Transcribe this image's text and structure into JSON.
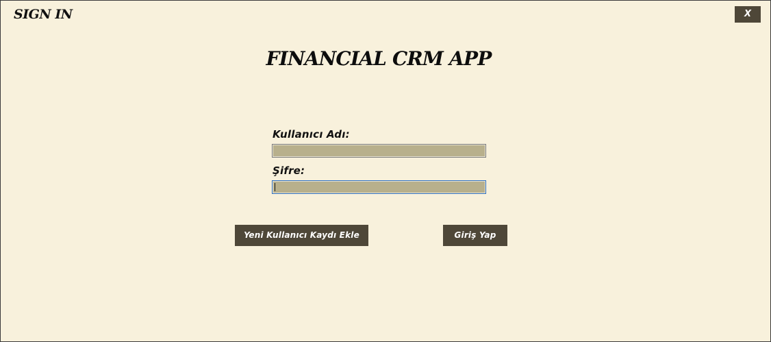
{
  "window": {
    "title": "SIGN IN",
    "close_label": "X"
  },
  "app": {
    "title": "FINANCIAL CRM APP"
  },
  "form": {
    "username_label": "Kullanıcı Adı:",
    "username_value": "",
    "password_label": "Şifre:",
    "password_value": ""
  },
  "buttons": {
    "register_label": "Yeni Kullanıcı Kaydı Ekle",
    "login_label": "Giriş Yap"
  },
  "colors": {
    "background": "#f8f1dc",
    "button": "#4e4738",
    "input": "#b8b08c",
    "focus_border": "#2f6fbd"
  }
}
